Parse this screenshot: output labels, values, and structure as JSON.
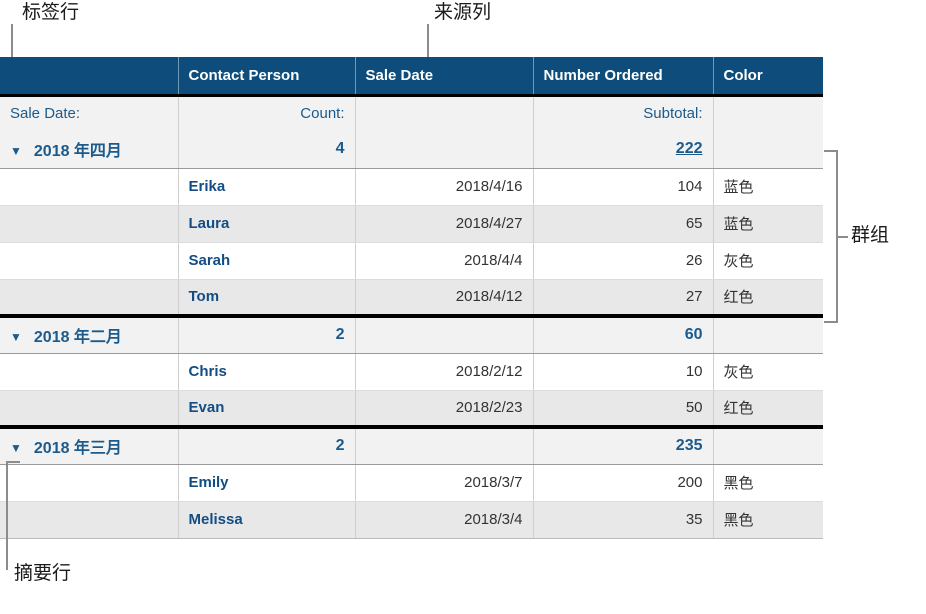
{
  "annotations": {
    "label_row": "标签行",
    "source_column": "来源列",
    "group": "群组",
    "summary_row": "摘要行"
  },
  "table": {
    "headers": [
      "",
      "Contact Person",
      "Sale Date",
      "Number Ordered",
      "Color"
    ],
    "label_row": {
      "category": "Sale Date:",
      "count": "Count:",
      "date": "",
      "subtotal": "Subtotal:",
      "color": ""
    },
    "disclosure_glyph": "▼",
    "groups": [
      {
        "name": "2018 年四月",
        "count": "4",
        "subtotal": "222",
        "subtotal_underlined": true,
        "rows": [
          {
            "person": "Erika",
            "date": "2018/4/16",
            "number": "104",
            "color": "蓝色"
          },
          {
            "person": "Laura",
            "date": "2018/4/27",
            "number": "65",
            "color": "蓝色"
          },
          {
            "person": "Sarah",
            "date": "2018/4/4",
            "number": "26",
            "color": "灰色"
          },
          {
            "person": "Tom",
            "date": "2018/4/12",
            "number": "27",
            "color": "红色"
          }
        ]
      },
      {
        "name": "2018 年二月",
        "count": "2",
        "subtotal": "60",
        "subtotal_underlined": false,
        "rows": [
          {
            "person": "Chris",
            "date": "2018/2/12",
            "number": "10",
            "color": "灰色"
          },
          {
            "person": "Evan",
            "date": "2018/2/23",
            "number": "50",
            "color": "红色"
          }
        ]
      },
      {
        "name": "2018 年三月",
        "count": "2",
        "subtotal": "235",
        "subtotal_underlined": false,
        "rows": [
          {
            "person": "Emily",
            "date": "2018/3/7",
            "number": "200",
            "color": "黑色"
          },
          {
            "person": "Melissa",
            "date": "2018/3/4",
            "number": "35",
            "color": "黑色"
          }
        ]
      }
    ]
  },
  "colors": {
    "header_blue": "#0e4d7b",
    "accent_text": "#1c5a8c",
    "name_text": "#134d84",
    "row_alt": "#e8e8e8",
    "group_bg": "#f2f2f2",
    "annotation_line": "#8c8c8c"
  }
}
